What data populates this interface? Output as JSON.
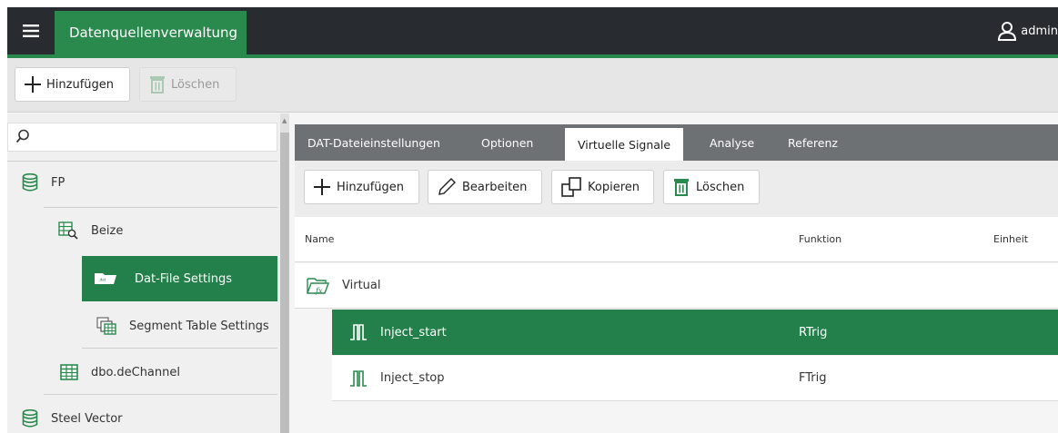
{
  "app": {
    "title": "Datenquellenverwaltung",
    "user": "admin",
    "accent": "#2a8a4e"
  },
  "toolbar": {
    "add_label": "Hinzufügen",
    "delete_label": "Löschen"
  },
  "tree": {
    "search_placeholder": "",
    "nodes": [
      {
        "label": "FP",
        "icon": "database-icon"
      },
      {
        "label": "Beize",
        "icon": "table-search-icon"
      },
      {
        "label": "Dat-File Settings",
        "icon": "dat-file-icon",
        "selected": true
      },
      {
        "label": "Segment Table Settings",
        "icon": "segment-table-icon"
      },
      {
        "label": "dbo.deChannel",
        "icon": "table-icon"
      },
      {
        "label": "Steel Vector",
        "icon": "database-icon"
      }
    ]
  },
  "tabs": [
    {
      "label": "DAT-Dateieinstellungen"
    },
    {
      "label": "Optionen"
    },
    {
      "label": "Virtuelle Signale",
      "active": true
    },
    {
      "label": "Analyse"
    },
    {
      "label": "Referenz"
    }
  ],
  "signals_toolbar": {
    "add_label": "Hinzufügen",
    "edit_label": "Bearbeiten",
    "copy_label": "Kopieren",
    "delete_label": "Löschen"
  },
  "table": {
    "columns": {
      "name": "Name",
      "function": "Funktion",
      "unit": "Einheit"
    },
    "group": {
      "label": "Virtual"
    },
    "rows": [
      {
        "name": "Inject_start",
        "function": "RTrig",
        "selected": true
      },
      {
        "name": "Inject_stop",
        "function": "FTrig",
        "selected": false
      }
    ]
  }
}
